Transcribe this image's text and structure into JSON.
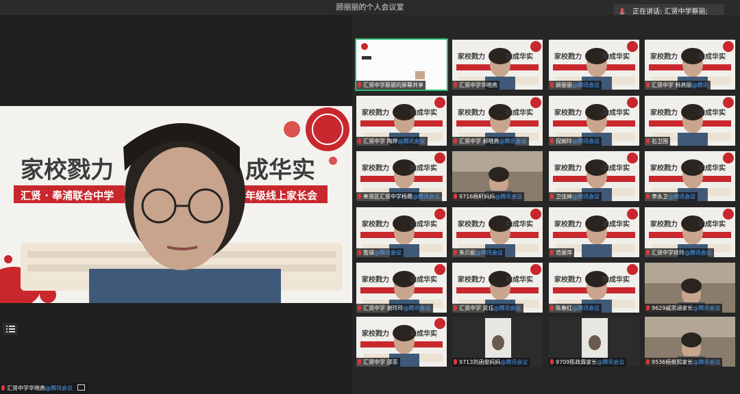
{
  "window": {
    "title": "顾丽丽的个人会议室"
  },
  "speaking": {
    "text": "正在讲话: 汇贤中学蔡丽;"
  },
  "main_video": {
    "banner_title_left": "家校戮力",
    "banner_title_right": "成华实",
    "school_name": "汇贤 · 奉浦联合中学",
    "event_tail": "年级线上家长会",
    "participant": "汇贤中学华晓燕",
    "participant_suffix": "@腾讯会议"
  },
  "tiles": [
    {
      "name": "汇贤中学蔡丽的屏幕共享",
      "suffix": "",
      "kind": "screen"
    },
    {
      "name": "汇贤中学华晓燕",
      "suffix": "",
      "kind": "poster"
    },
    {
      "name": "顾丽丽",
      "suffix": "@腾讯会议",
      "kind": "poster"
    },
    {
      "name": "汇贤中学 韩燕丽",
      "suffix": "@腾讯",
      "kind": "poster"
    },
    {
      "name": "汇贤中学 陶烨",
      "suffix": "@腾讯会议",
      "kind": "poster"
    },
    {
      "name": "汇贤中学 郝晓燕",
      "suffix": "@腾讯会议",
      "kind": "poster"
    },
    {
      "name": "倪婉玲",
      "suffix": "@腾讯会议",
      "kind": "poster"
    },
    {
      "name": "石卫国",
      "suffix": "",
      "kind": "poster"
    },
    {
      "name": "奉贤区汇贤中学杨霞",
      "suffix": "@腾讯会议",
      "kind": "poster"
    },
    {
      "name": "9716杨轩妈妈",
      "suffix": "@腾讯会议",
      "kind": "room"
    },
    {
      "name": "卫佳婷",
      "suffix": "@腾讯会议",
      "kind": "poster"
    },
    {
      "name": "李永卫",
      "suffix": "@腾讯会议",
      "kind": "poster"
    },
    {
      "name": "詹瑛",
      "suffix": "@腾讯会议",
      "kind": "poster"
    },
    {
      "name": "朱贝妮",
      "suffix": "@腾讯会议",
      "kind": "poster"
    },
    {
      "name": "范丽萍",
      "suffix": "",
      "kind": "poster"
    },
    {
      "name": "汇贤中学徐玲",
      "suffix": "@腾讯会议",
      "kind": "poster"
    },
    {
      "name": "汇贤中学 谢玲玲",
      "suffix": "@腾讯会议",
      "kind": "poster"
    },
    {
      "name": "汇贤中学 吴珏",
      "suffix": "@腾讯会议",
      "kind": "poster"
    },
    {
      "name": "陈春红",
      "suffix": "@腾讯会议",
      "kind": "poster"
    },
    {
      "name": "9629戚思涵家长",
      "suffix": "@腾讯会议",
      "kind": "room"
    },
    {
      "name": "汇贤中学 邵菲",
      "suffix": "",
      "kind": "poster"
    },
    {
      "name": "9713刘函俊妈妈",
      "suffix": "@腾讯会议",
      "kind": "dark"
    },
    {
      "name": "9709陈政霖家长",
      "suffix": "@腾讯会议",
      "kind": "dark"
    },
    {
      "name": "9536杨筱熙家长",
      "suffix": "@腾讯会议",
      "kind": "room"
    }
  ],
  "tile_banner": {
    "left": "家校戮力",
    "right": "功成华实"
  },
  "colors": {
    "brand_red": "#c8282d",
    "accent_blue": "#4ea3ff",
    "active_green": "#2bb673"
  }
}
